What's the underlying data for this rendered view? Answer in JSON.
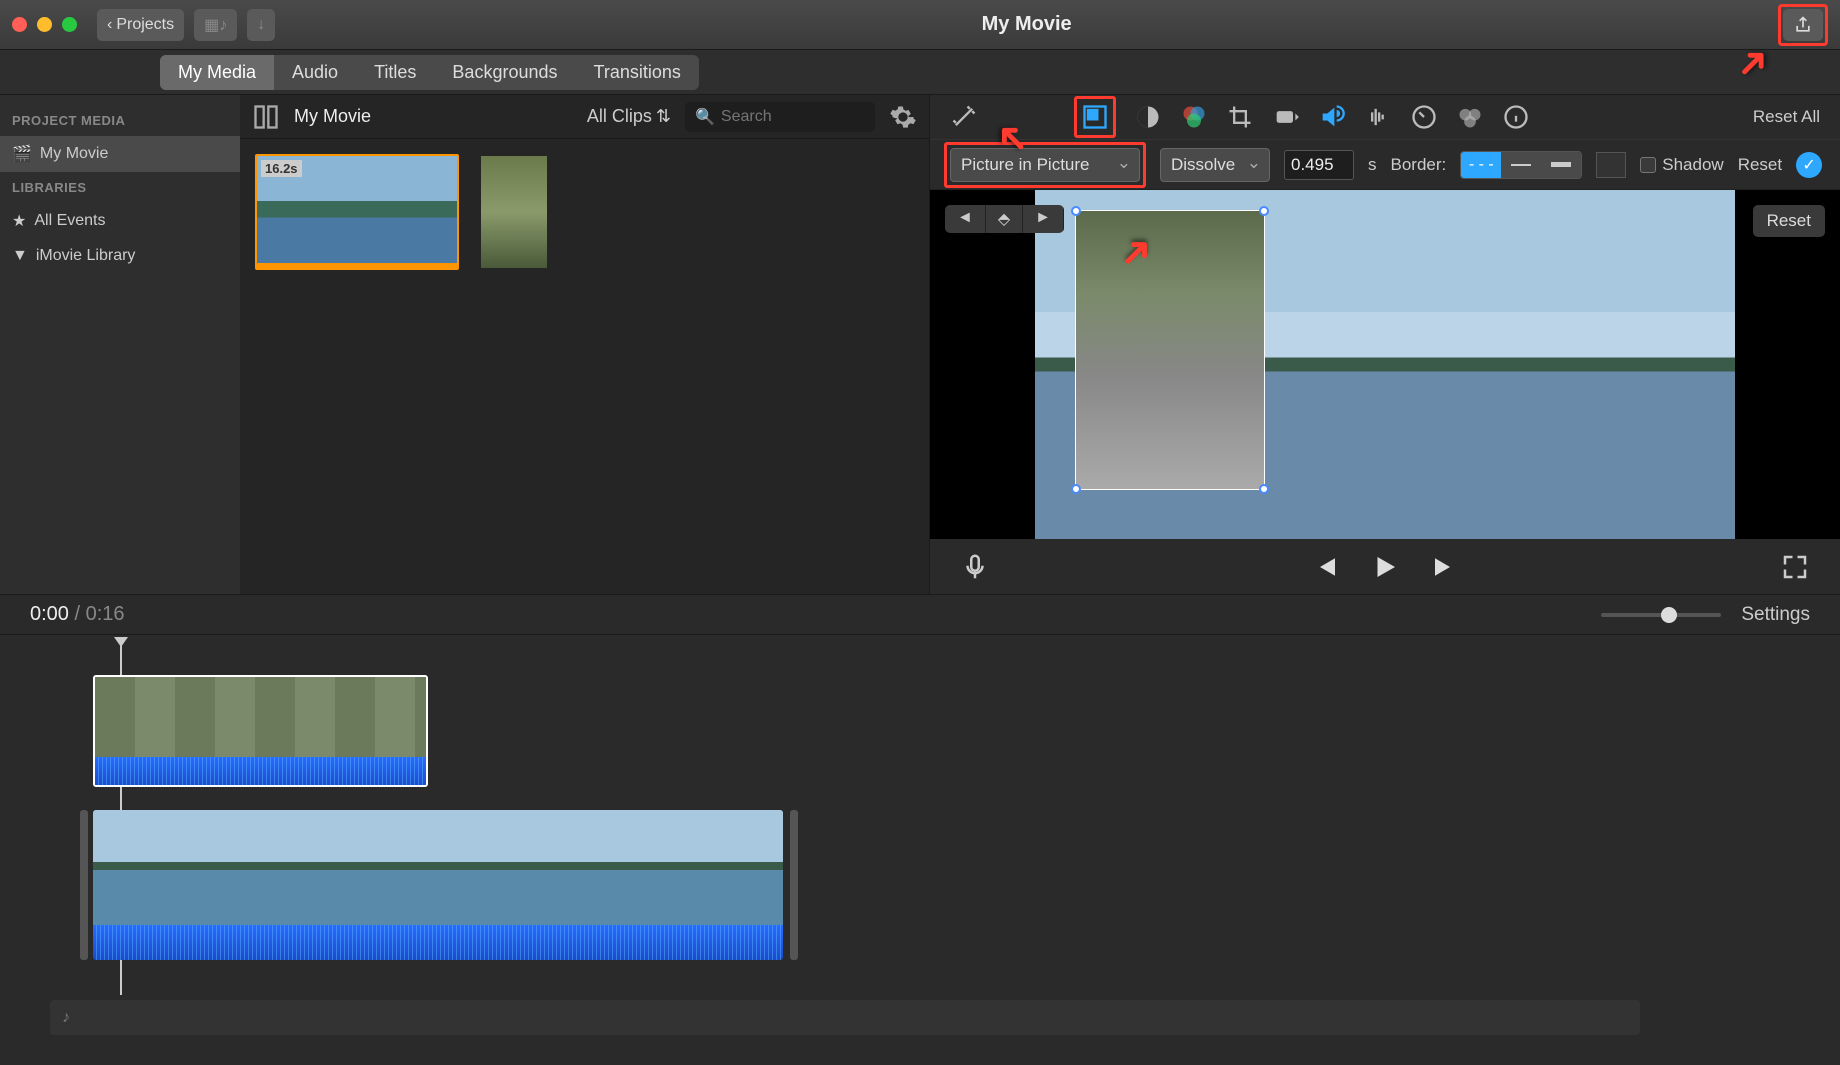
{
  "titlebar": {
    "title": "My Movie",
    "back": "Projects"
  },
  "tabs": [
    "My Media",
    "Audio",
    "Titles",
    "Backgrounds",
    "Transitions"
  ],
  "active_tab": 0,
  "sidebar": {
    "project_media": "PROJECT MEDIA",
    "project_item": "My Movie",
    "libraries": "LIBRARIES",
    "all_events": "All Events",
    "imovie_library": "iMovie Library"
  },
  "browser": {
    "title": "My Movie",
    "filter": "All Clips",
    "search_ph": "Search",
    "clip1_dur": "16.2s"
  },
  "adjust": {
    "reset_all": "Reset All"
  },
  "options": {
    "mode": "Picture in Picture",
    "dissolve": "Dissolve",
    "num": "0.495",
    "sec": "s",
    "border": "Border:",
    "shadow": "Shadow",
    "reset": "Reset"
  },
  "viewer": {
    "reset": "Reset"
  },
  "time": {
    "cur": "0:00",
    "total": "0:16",
    "settings": "Settings"
  }
}
